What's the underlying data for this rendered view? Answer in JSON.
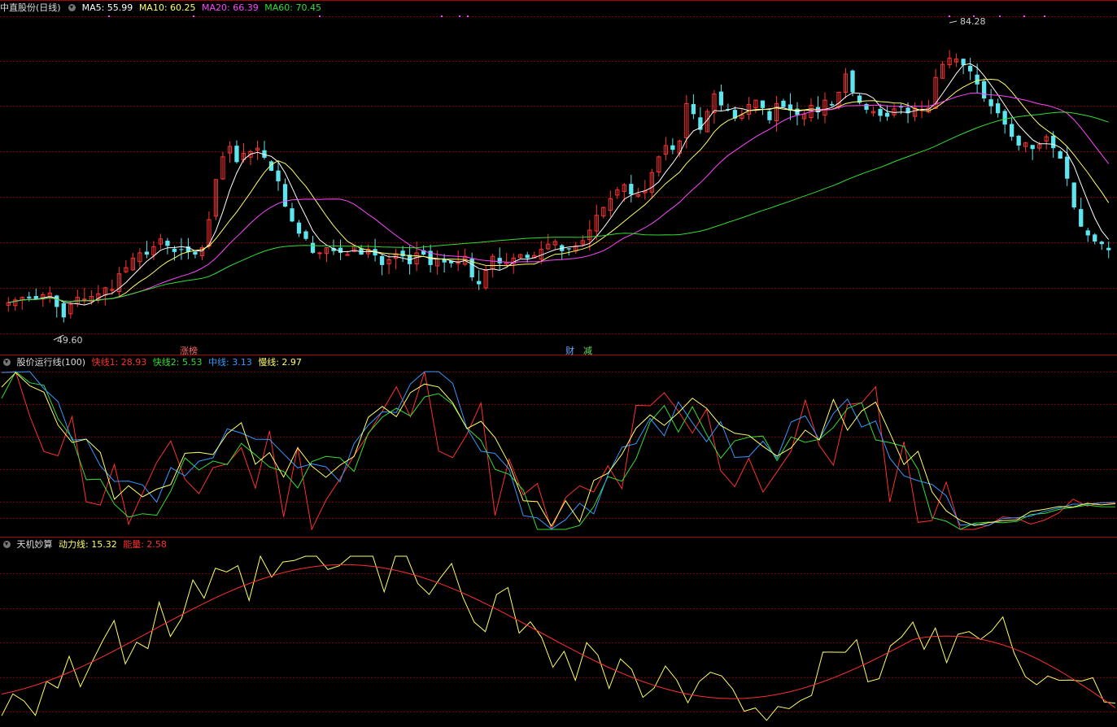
{
  "main": {
    "title": "中直股份(日线)",
    "ma": [
      {
        "label": "MA5: 55.99",
        "color": "#ffffff"
      },
      {
        "label": "MA10: 60.25",
        "color": "#ffff66"
      },
      {
        "label": "MA20: 66.39",
        "color": "#ff44ff"
      },
      {
        "label": "MA60: 70.45",
        "color": "#33dd33"
      }
    ],
    "high_label": "84.28",
    "low_label": "49.60",
    "events": [
      {
        "text": "涨榜",
        "color": "#ff6666"
      },
      {
        "text": "财",
        "color": "#66aaff"
      },
      {
        "text": "减",
        "color": "#66dd66"
      }
    ]
  },
  "ind1": {
    "name": "股价运行线(100)",
    "lines": [
      {
        "label": "快线1: 28.93",
        "color": "#ff3030"
      },
      {
        "label": "快线2: 5.53",
        "color": "#33dd33"
      },
      {
        "label": "中线: 3.13",
        "color": "#3399ff"
      },
      {
        "label": "慢线: 2.97",
        "color": "#ffff66"
      }
    ]
  },
  "ind2": {
    "name": "天机妙算",
    "lines": [
      {
        "label": "动力线: 15.32",
        "color": "#ffff66"
      },
      {
        "label": "能量: 2.58",
        "color": "#ff3030"
      }
    ]
  },
  "colors": {
    "up": "#ff3333",
    "down": "#5ee6f0",
    "ma5": "#ffffff",
    "ma10": "#ffff66",
    "ma20": "#ff44ff",
    "ma60": "#33dd33"
  },
  "chart_data": [
    {
      "type": "candlestick",
      "title": "中直股份(日线)",
      "price_range_approx": [
        49.6,
        84.28
      ],
      "labeled_extremes": {
        "high": 84.28,
        "low": 49.6
      },
      "series": [
        {
          "name": "MA5",
          "last": 55.99
        },
        {
          "name": "MA10",
          "last": 60.25
        },
        {
          "name": "MA20",
          "last": 66.39
        },
        {
          "name": "MA60",
          "last": 70.45
        }
      ],
      "close_approx": [
        52.5,
        52.8,
        53.1,
        53.0,
        52.9,
        53.4,
        53.6,
        52.0,
        50.8,
        52.3,
        53.1,
        52.9,
        53.2,
        53.5,
        54.2,
        54.0,
        55.8,
        56.5,
        57.6,
        58.2,
        58.0,
        58.9,
        59.8,
        59.0,
        58.3,
        58.6,
        58.3,
        58.0,
        58.8,
        62.0,
        66.6,
        69.2,
        70.4,
        68.6,
        69.6,
        69.8,
        70.2,
        69.1,
        67.6,
        66.4,
        63.5,
        61.8,
        60.4,
        59.8,
        58.2,
        58.2,
        58.8,
        58.4,
        58.2,
        58.0,
        59.0,
        58.0,
        58.6,
        57.9,
        56.8,
        57.4,
        58.1,
        57.8,
        56.9,
        58.2,
        58.0,
        56.8,
        57.5,
        57.1,
        57.0,
        57.2,
        57.8,
        55.4,
        54.6,
        56.2,
        57.8,
        57.0,
        57.1,
        57.6,
        58.0,
        57.6,
        57.9,
        58.6,
        59.2,
        59.5,
        58.4,
        58.6,
        59.0,
        59.6,
        60.8,
        62.5,
        63.4,
        64.4,
        65.4,
        66.0,
        64.9,
        64.9,
        65.3,
        67.4,
        69.2,
        70.5,
        70.0,
        71.0,
        75.3,
        74.1,
        72.3,
        74.4,
        76.4,
        75.1,
        74.6,
        73.6,
        74.0,
        75.2,
        75.7,
        74.8,
        73.4,
        75.3,
        74.9,
        74.5,
        74.0,
        74.1,
        75.1,
        74.3,
        75.7,
        75.1,
        76.6,
        78.7,
        76.6,
        75.4,
        74.6,
        74.4,
        73.9,
        73.8,
        74.7,
        74.9,
        74.2,
        74.8,
        74.6,
        74.8,
        78.3,
        79.8,
        80.5,
        80.4,
        79.7,
        79.0,
        77.5,
        75.9,
        75.0,
        74.2,
        72.9,
        71.5,
        70.5,
        70.8,
        70.1,
        70.6,
        71.5,
        70.2,
        69.0,
        66.7,
        63.4,
        61.2,
        60.2,
        59.5,
        59.2,
        58.5
      ]
    },
    {
      "type": "line",
      "title": "股价运行线(100)",
      "series": [
        {
          "name": "快线1",
          "last": 28.93
        },
        {
          "name": "快线2",
          "last": 5.53
        },
        {
          "name": "中线",
          "last": 3.13
        },
        {
          "name": "慢线",
          "last": 2.97
        }
      ]
    },
    {
      "type": "line",
      "title": "天机妙算",
      "series": [
        {
          "name": "动力线",
          "last": 15.32
        },
        {
          "name": "能量",
          "last": 2.58
        }
      ]
    }
  ]
}
